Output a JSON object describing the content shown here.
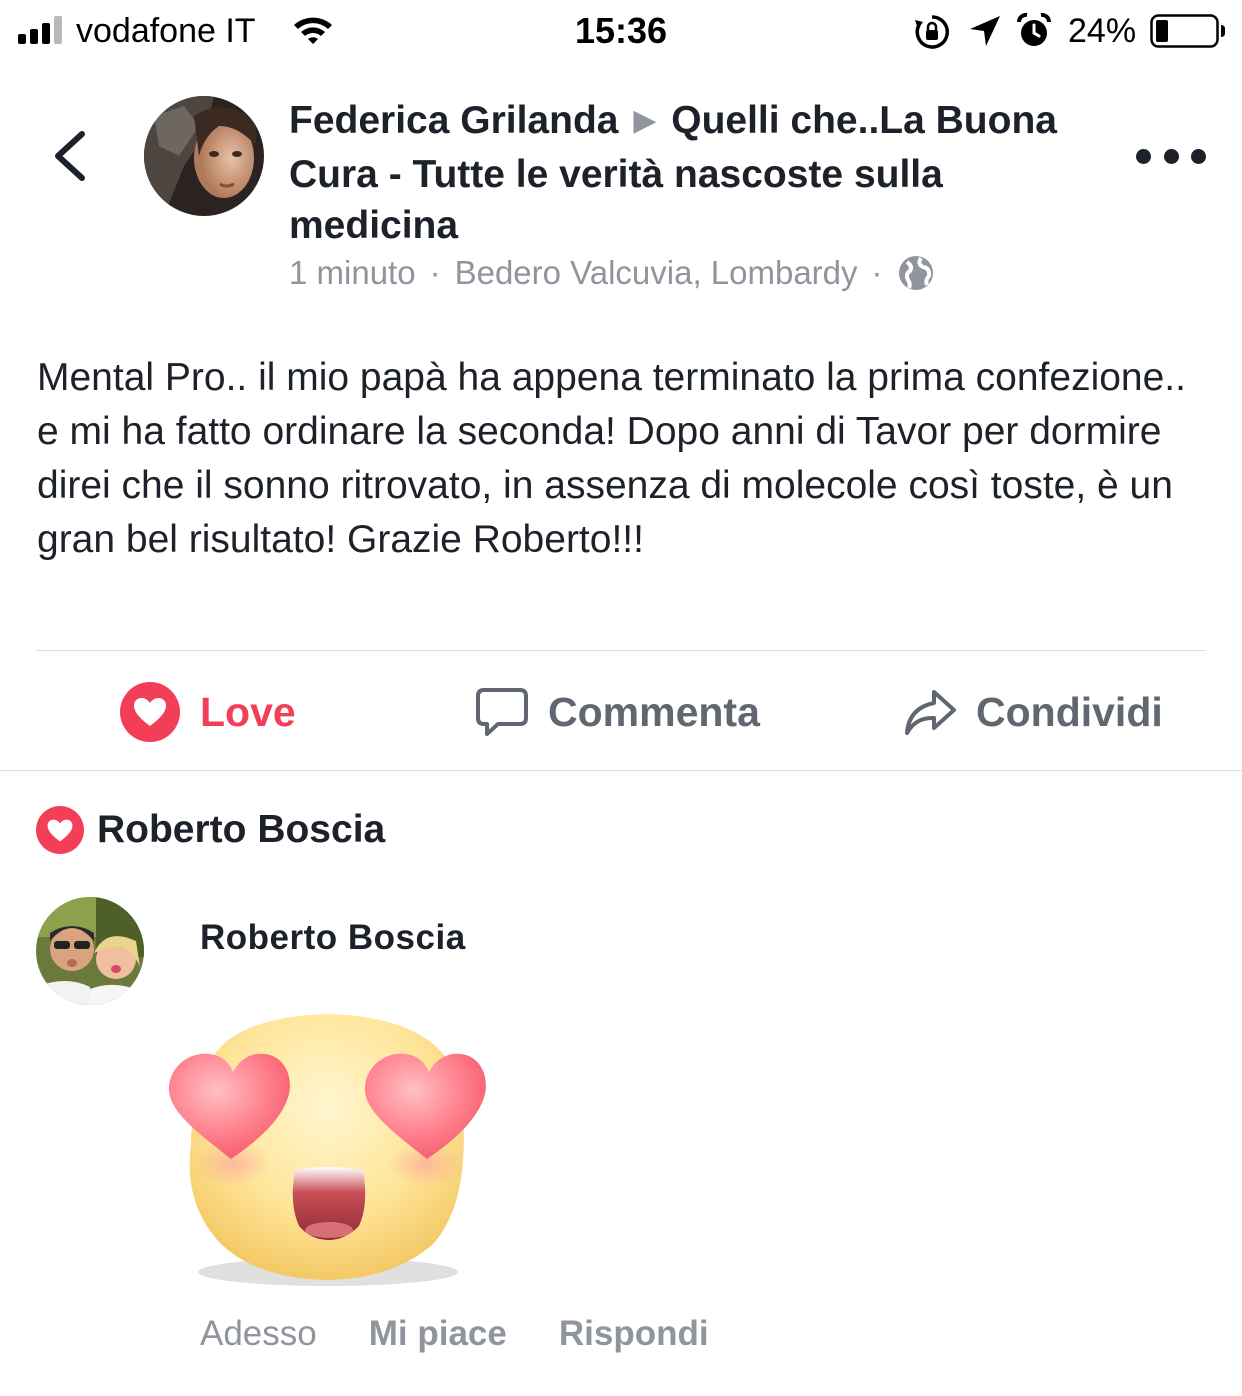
{
  "status_bar": {
    "carrier": "vodafone IT",
    "time": "15:36",
    "battery_percent": "24%",
    "battery_level": 0.24
  },
  "header": {
    "author": "Federica Grilanda",
    "separator": "▶",
    "group": "Quelli che..La Buona Cura - Tutte le verità nascoste sulla medicina",
    "time_ago": "1 minuto",
    "location": "Bedero Valcuvia, Lombardy",
    "meta_dot": "·",
    "privacy_icon": "globe-icon"
  },
  "post": {
    "text": "Mental Pro.. il mio papà ha appena terminato la prima confezione.. e mi ha fatto ordinare la seconda! Dopo anni di Tavor per dormire direi che il sonno ritrovato, in assenza di molecole così toste, è un gran bel risultato! Grazie Roberto!!!"
  },
  "actions": {
    "love_label": "Love",
    "comment_label": "Commenta",
    "share_label": "Condividi"
  },
  "reactions": {
    "name": "Roberto Boscia"
  },
  "comment": {
    "author": "Roberto Boscia",
    "sticker": "heart-eyes-sticker",
    "timestamp": "Adesso",
    "like_label": "Mi piace",
    "reply_label": "Rispondi"
  },
  "colors": {
    "love": "#f33e58",
    "text": "#1d2129",
    "secondary": "#90949c",
    "action_grey": "#606770",
    "divider": "#dadde1"
  }
}
